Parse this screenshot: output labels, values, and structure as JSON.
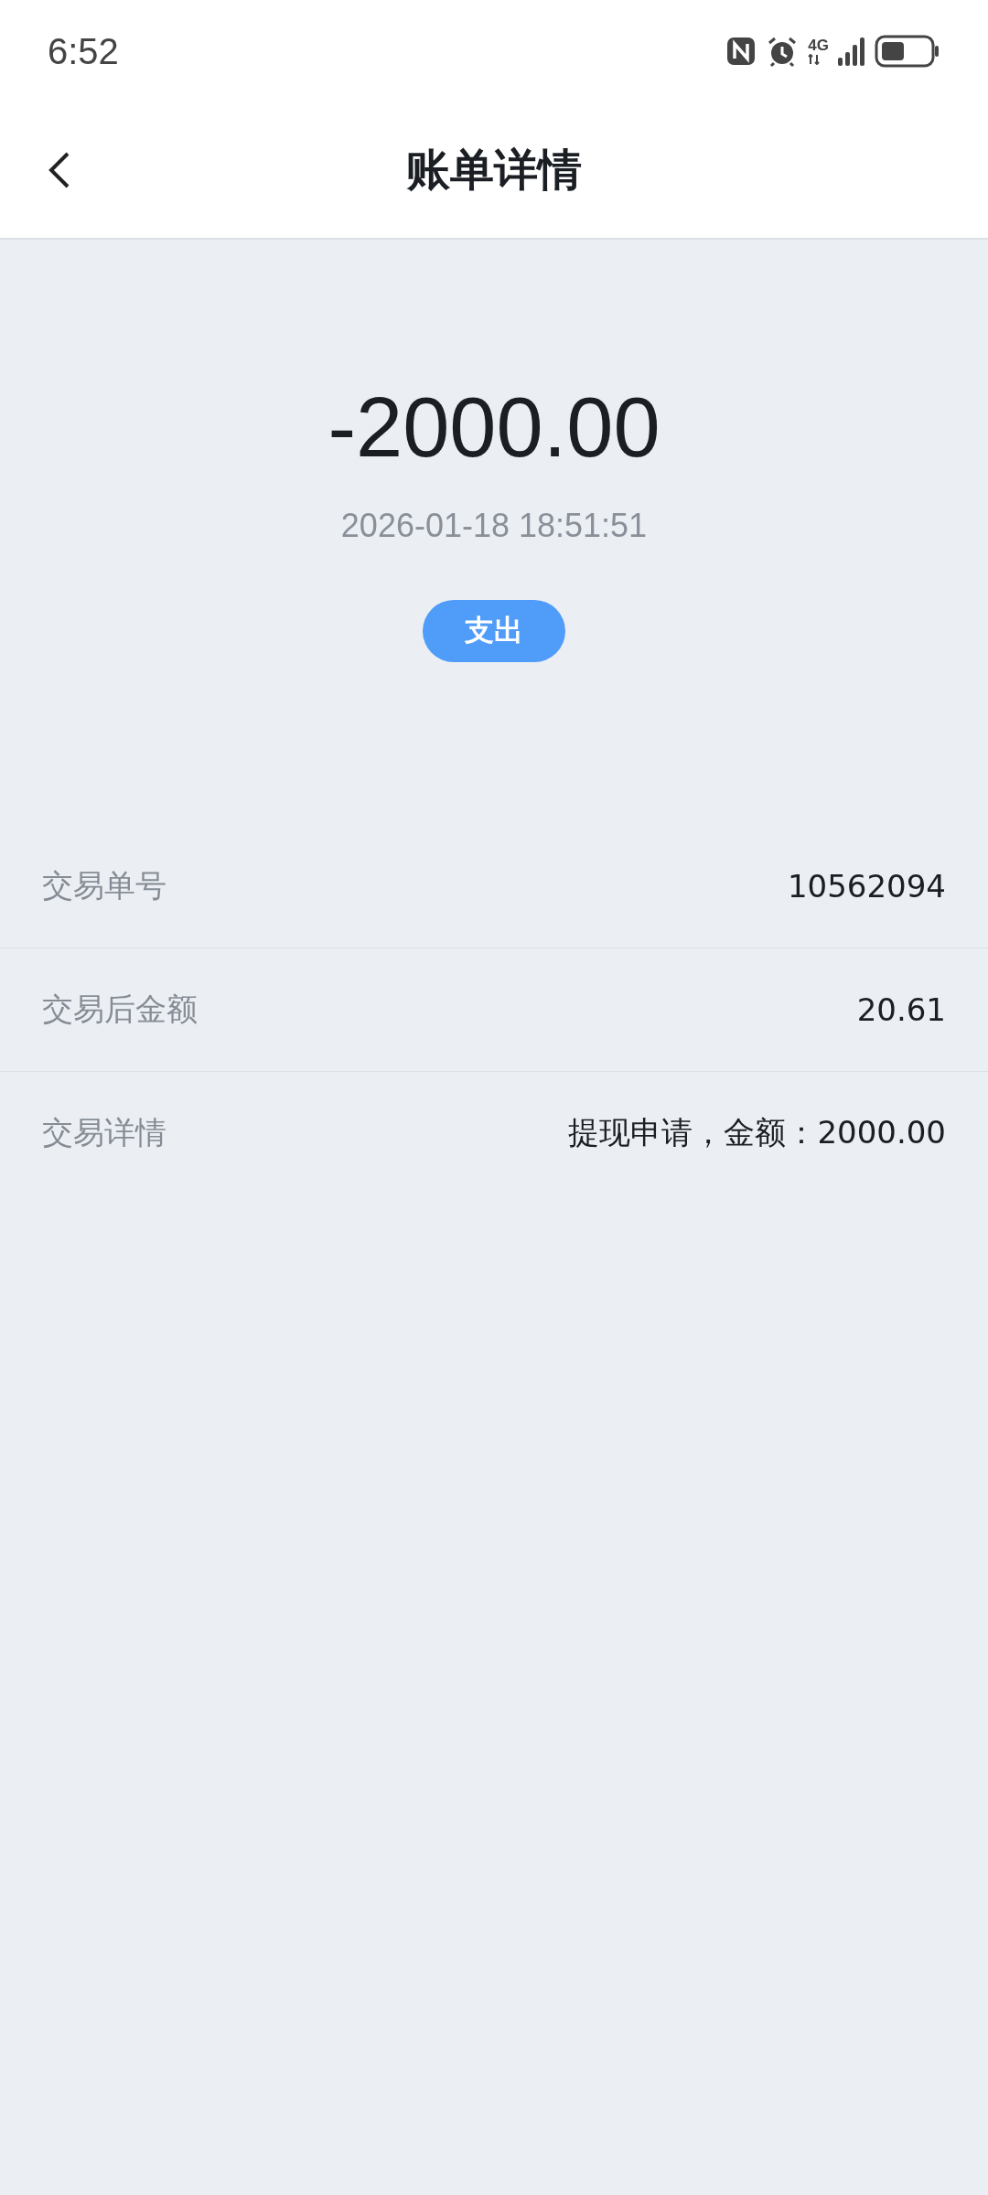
{
  "status_bar": {
    "time": "6:52",
    "network": "4G"
  },
  "header": {
    "title": "账单详情"
  },
  "summary": {
    "amount": "-2000.00",
    "datetime": "2026-01-18 18:51:51",
    "tag": "支出"
  },
  "details": [
    {
      "label": "交易单号",
      "value": "10562094"
    },
    {
      "label": "交易后金额",
      "value": "20.61"
    },
    {
      "label": "交易详情",
      "value": "提现申请，金额：2000.00"
    }
  ]
}
